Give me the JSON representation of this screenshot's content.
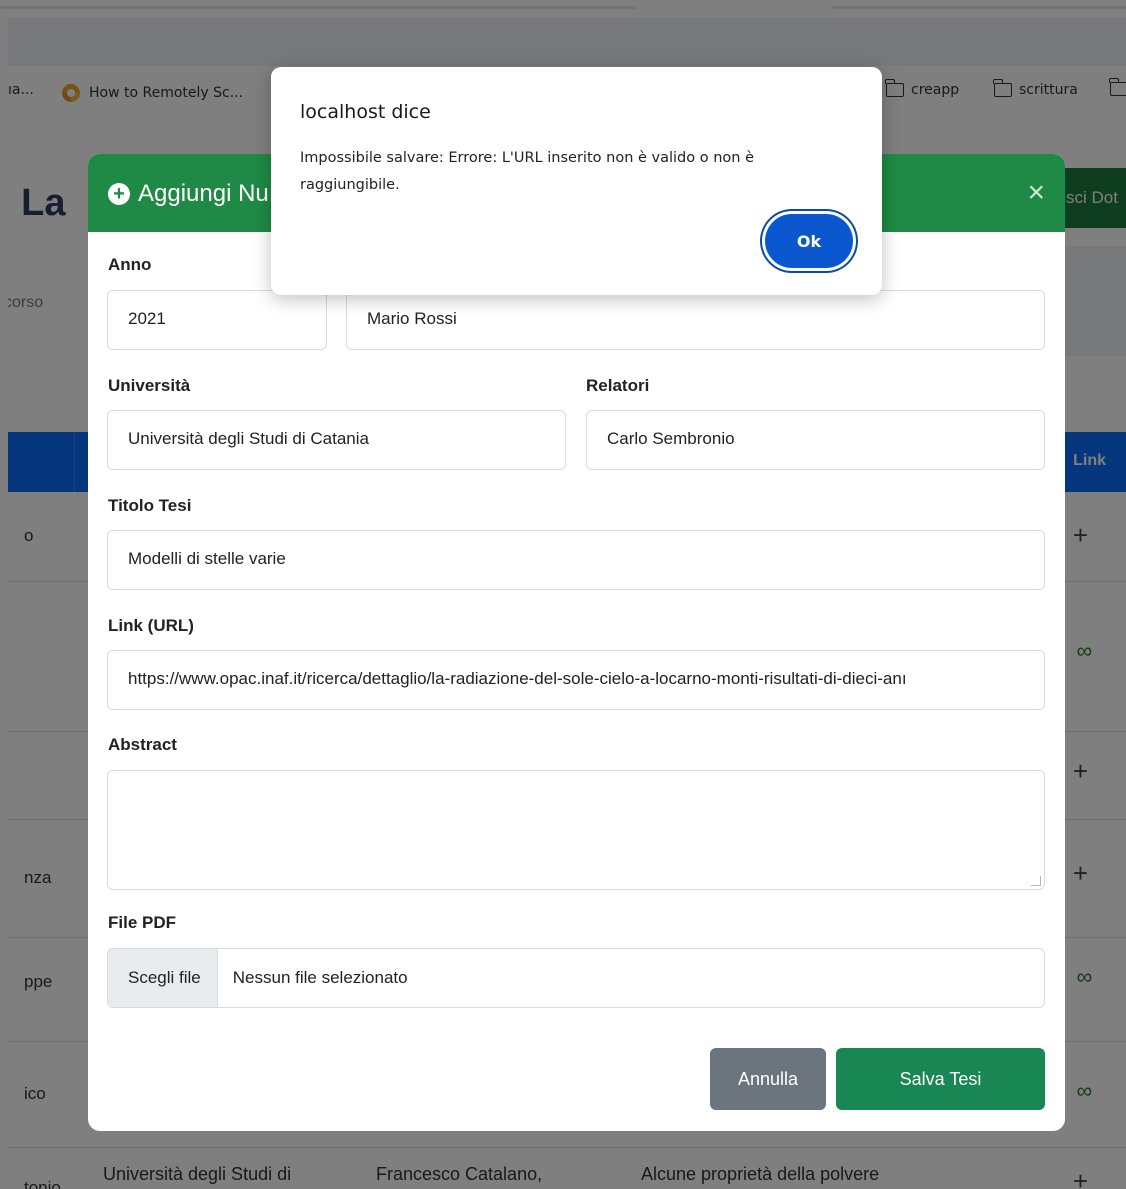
{
  "bookmarks": {
    "item_partial": "ıa...",
    "item_howto": "How to Remotely Sc...",
    "folder_creapp": "creapp",
    "folder_scrittura": "scrittura"
  },
  "page": {
    "title_partial": "i La",
    "subtitle_partial": "corso",
    "header_button_partial": "sci Dot",
    "table_link_header_partial": "Link",
    "rows": [
      {
        "left_text": "o",
        "action": "+"
      },
      {
        "left_text": "",
        "action": "chain"
      },
      {
        "left_text": "",
        "action": "+"
      },
      {
        "left_text": "nza",
        "action": "+"
      },
      {
        "left_text": "ppe",
        "action": "chain"
      },
      {
        "left_text": "ico",
        "action": "chain"
      }
    ],
    "bottom_row": {
      "left_text": "tonio",
      "university": "Università degli Studi di",
      "relatori": "Francesco Catalano,",
      "titolo": "Alcune proprietà della polvere",
      "action": "+"
    }
  },
  "modal": {
    "title": "Aggiungi Nu",
    "close_symbol": "×",
    "fields": {
      "anno_label": "Anno",
      "anno_value": "2021",
      "autore_value": "Mario Rossi",
      "universita_label": "Università",
      "universita_value": "Università degli Studi di Catania",
      "relatori_label": "Relatori",
      "relatori_value": "Carlo Sembronio",
      "titolo_label": "Titolo Tesi",
      "titolo_value": "Modelli di stelle varie",
      "link_label": "Link (URL)",
      "link_value": "https://www.opac.inaf.it/ricerca/dettaglio/la-radiazione-del-sole-cielo-a-locarno-monti-risultati-di-dieci-anı",
      "abstract_label": "Abstract",
      "abstract_value": "",
      "pdf_label": "File PDF",
      "pdf_button": "Scegli file",
      "pdf_status": "Nessun file selezionato"
    },
    "buttons": {
      "cancel": "Annulla",
      "save": "Salva Tesi"
    }
  },
  "alert": {
    "title": "localhost dice",
    "message": "Impossibile salvare: Errore: L'URL inserito non è valido o non è raggiungibile.",
    "ok": "Ok"
  },
  "colors": {
    "modal_header": "#1f8a45",
    "table_header": "#0d6efd",
    "alert_ok": "#0b57d0",
    "save_button": "#198754",
    "cancel_button": "#6c757d"
  }
}
